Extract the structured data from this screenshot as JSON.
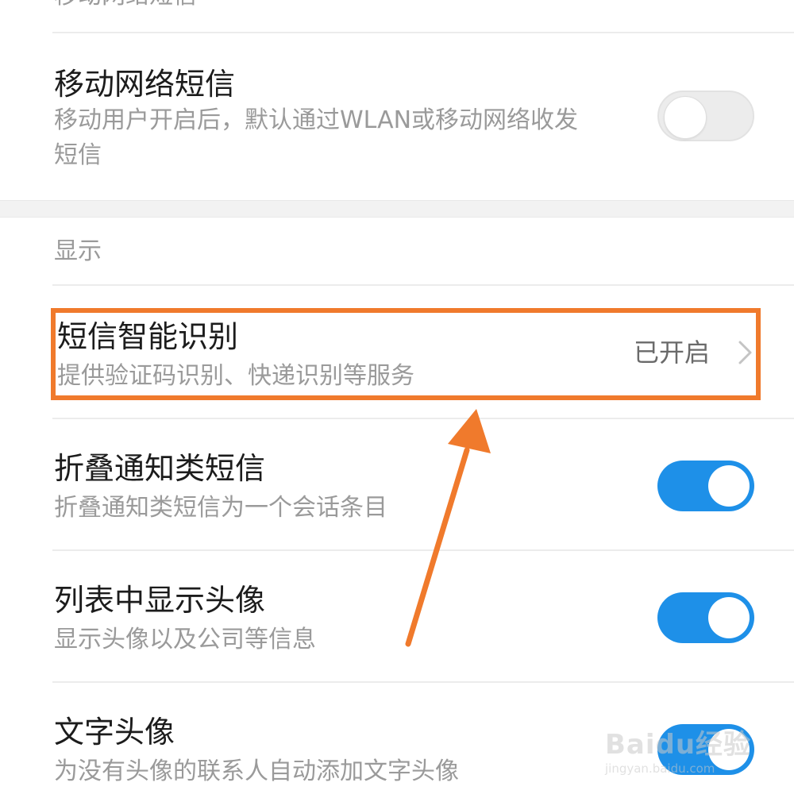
{
  "top_partial_label": "移动网络短信",
  "mobile_sms": {
    "title": "移动网络短信",
    "description_line1": "移动用户开启后，默认通过WLAN或移动网络收发",
    "description_line2": "短信",
    "enabled": false
  },
  "display_section": {
    "label": "显示"
  },
  "smart_recognition": {
    "title": "短信智能识别",
    "description": "提供验证码识别、快递识别等服务",
    "status": "已开启"
  },
  "fold_notifications": {
    "title": "折叠通知类短信",
    "description": "折叠通知类短信为一个会话条目",
    "enabled": true
  },
  "show_avatar": {
    "title": "列表中显示头像",
    "description": "显示头像以及公司等信息",
    "enabled": true
  },
  "text_avatar": {
    "title": "文字头像",
    "description": "为没有头像的联系人自动添加文字头像",
    "enabled": true
  },
  "watermark": {
    "brand": "Baidu经验",
    "url": "jingyan.baidu.com"
  },
  "colors": {
    "toggle_on": "#1e90e8",
    "highlight": "#f07a2c",
    "arrow": "#f07a2c"
  }
}
